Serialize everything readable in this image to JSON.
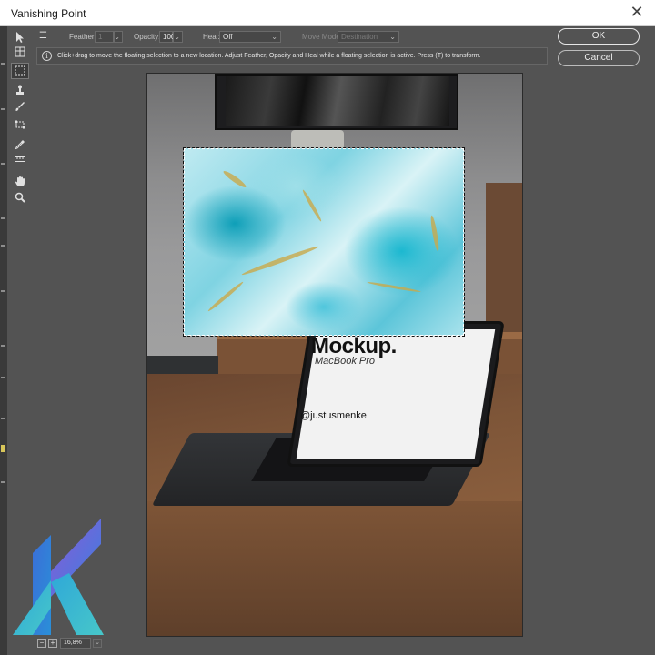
{
  "window": {
    "title": "Vanishing Point",
    "close_glyph": "✕"
  },
  "options_bar": {
    "feather_label": "Feather:",
    "feather_value": "1",
    "opacity_label": "Opacity:",
    "opacity_value": "100",
    "heal_label": "Heal:",
    "heal_value": "Off",
    "move_mode_label": "Move Mode:",
    "move_mode_value": "Destination",
    "dropdown_caret": "⌄"
  },
  "info": {
    "icon": "info-icon",
    "message": "Click+drag to move the floating selection to a new location. Adjust Feather, Opacity and Heal while a floating selection is active. Press (T) to transform."
  },
  "buttons": {
    "ok": "OK",
    "cancel": "Cancel"
  },
  "tools": [
    {
      "name": "edit-plane-tool-icon"
    },
    {
      "name": "create-plane-tool-icon"
    },
    {
      "name": "marquee-tool-icon",
      "active": true
    },
    {
      "name": "stamp-tool-icon"
    },
    {
      "name": "brush-tool-icon"
    },
    {
      "name": "transform-tool-icon"
    },
    {
      "name": "eyedropper-tool-icon"
    },
    {
      "name": "measure-tool-icon"
    },
    {
      "name": "hand-tool-icon"
    },
    {
      "name": "zoom-tool-icon"
    }
  ],
  "canvas": {
    "mockup_title": "Mockup.",
    "mockup_subtitle": "MacBook Pro",
    "mockup_handle": "@justusmenke"
  },
  "status_bar": {
    "zoom_out": "−",
    "zoom_in": "+",
    "zoom_value": "16,8%",
    "zoom_caret": "⌄"
  },
  "colors": {
    "dialog_bg": "#535353",
    "accent_selection": "#ffffff"
  }
}
